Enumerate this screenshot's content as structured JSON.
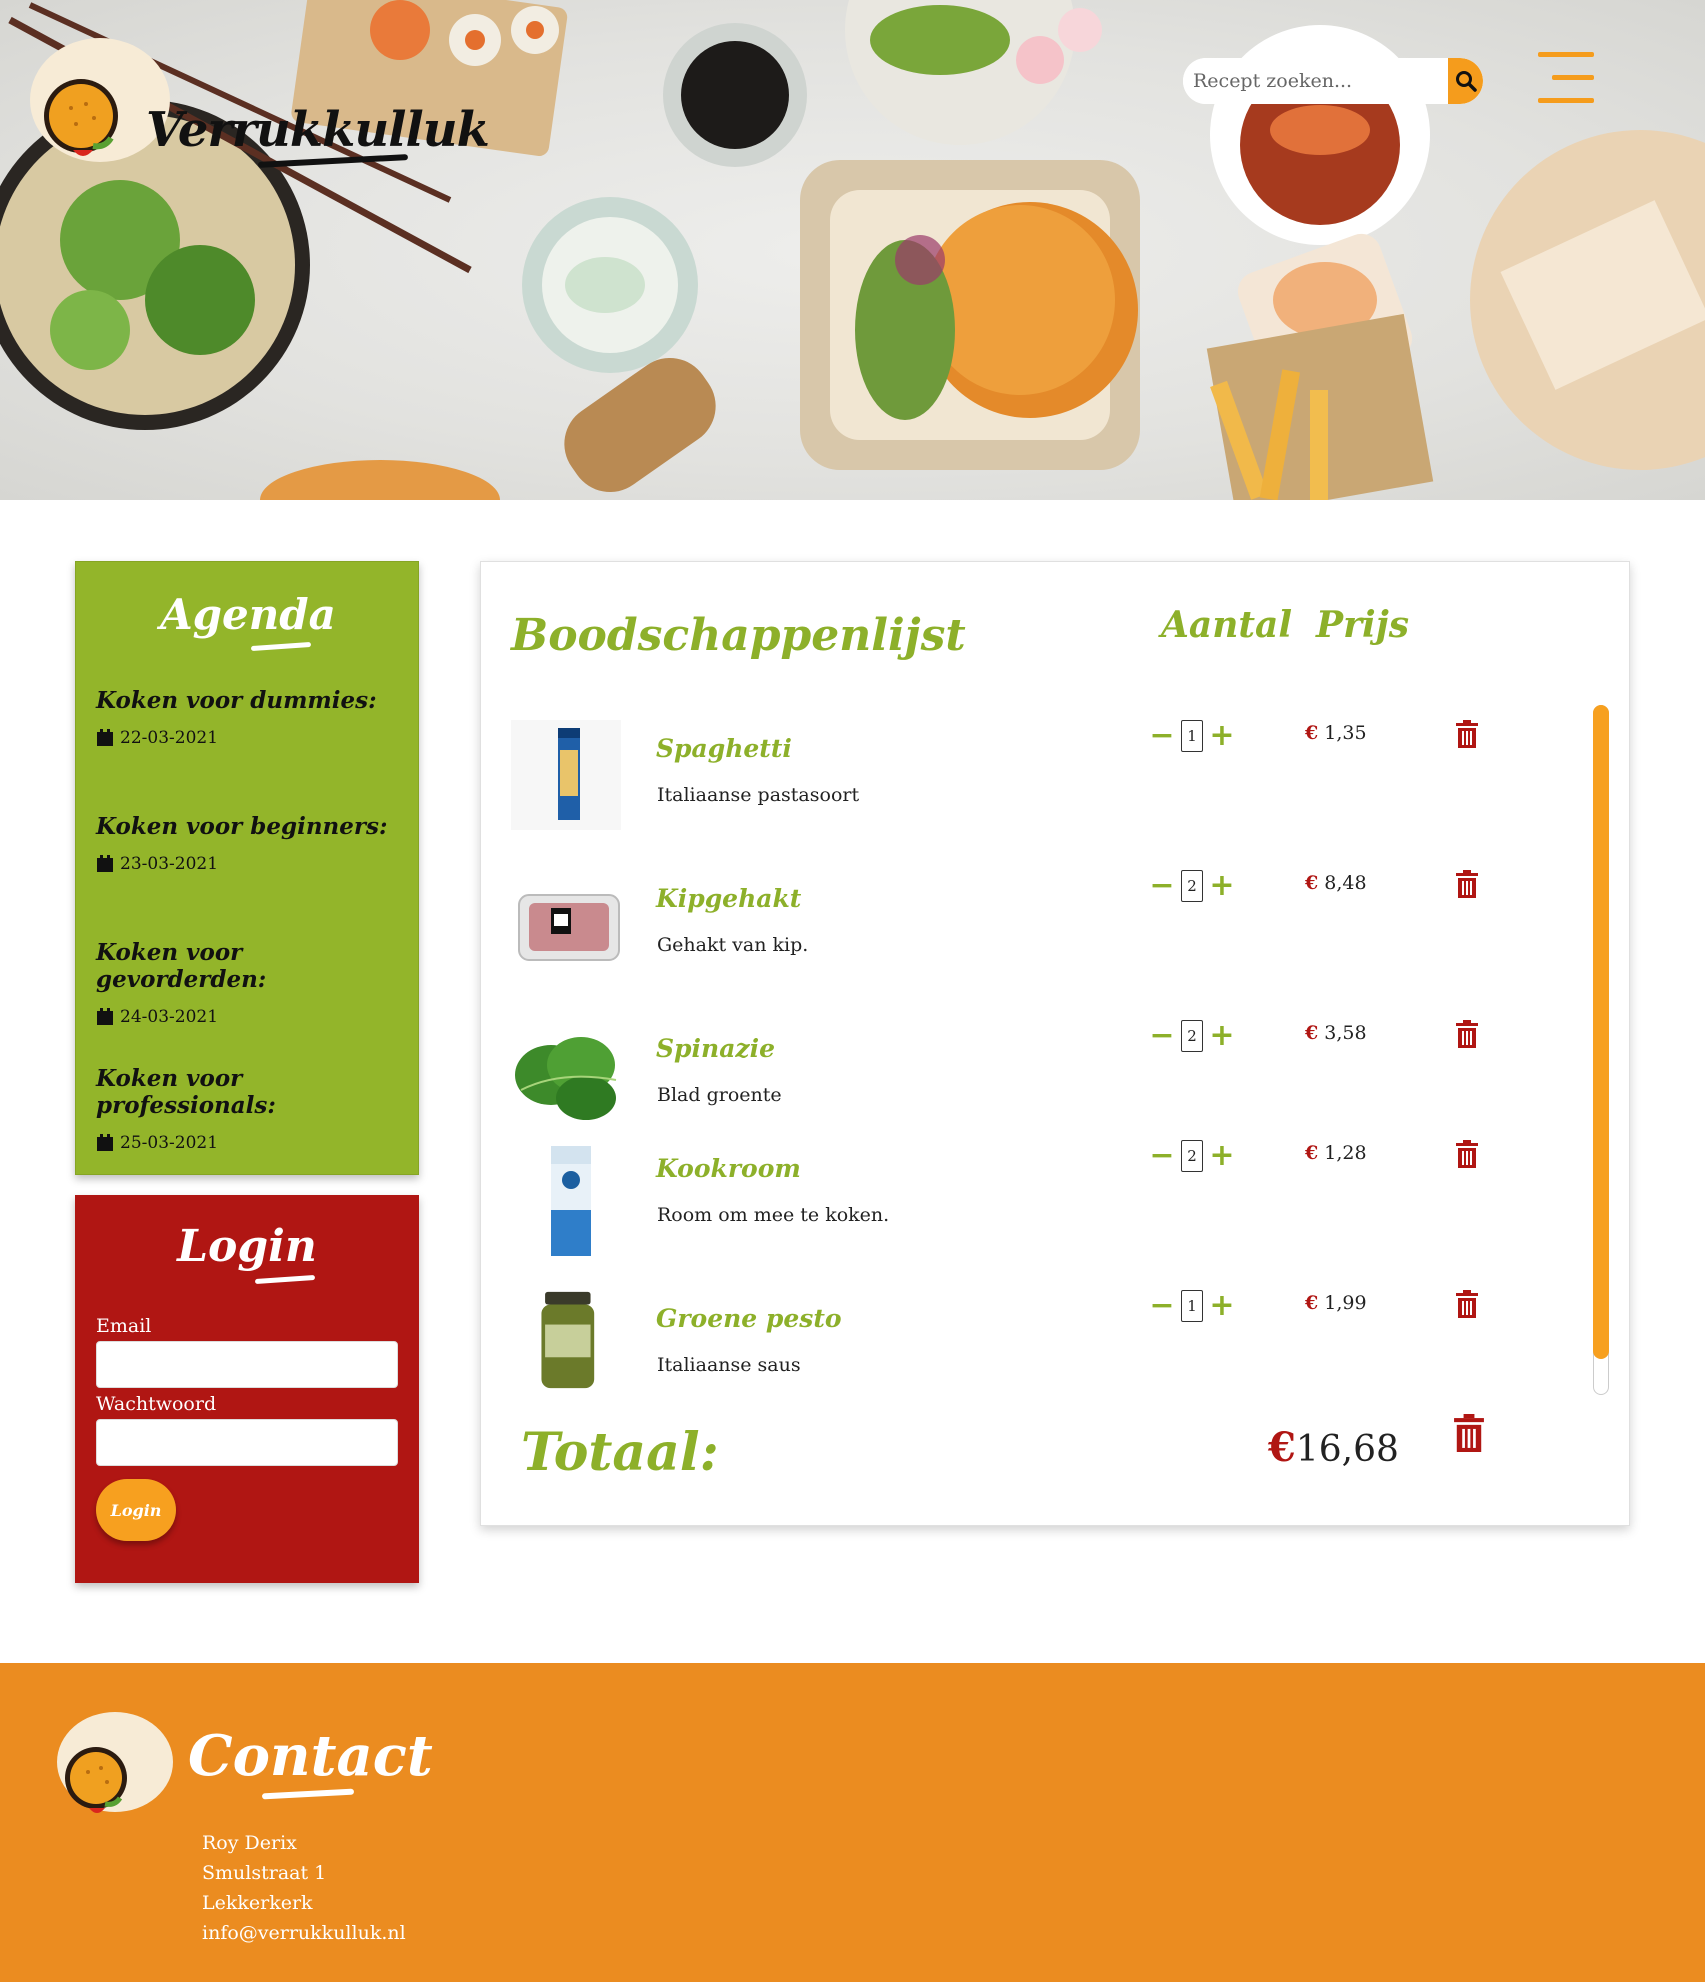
{
  "header": {
    "logo_text": "Verrukkulluk",
    "search_placeholder": "Recept zoeken..."
  },
  "agenda": {
    "title": "Agenda",
    "items": [
      {
        "name": "Koken voor dummies:",
        "date": "22-03-2021"
      },
      {
        "name": "Koken voor beginners:",
        "date": "23-03-2021"
      },
      {
        "name": "Koken voor gevorderden:",
        "date": "24-03-2021"
      },
      {
        "name": "Koken voor professionals:",
        "date": "25-03-2021"
      }
    ]
  },
  "login": {
    "title": "Login",
    "email_label": "Email",
    "password_label": "Wachtwoord",
    "button_label": "Login"
  },
  "list": {
    "title": "Boodschappenlijst",
    "col_aantal": "Aantal",
    "col_prijs": "Prijs",
    "currency": "€",
    "items": [
      {
        "name": "Spaghetti",
        "description": "Italiaanse pastasoort",
        "qty": "1",
        "price": "1,35"
      },
      {
        "name": "Kipgehakt",
        "description": "Gehakt van kip.",
        "qty": "2",
        "price": "8,48"
      },
      {
        "name": "Spinazie",
        "description": "Blad groente",
        "qty": "2",
        "price": "3,58"
      },
      {
        "name": "Kookroom",
        "description": "Room om mee te koken.",
        "qty": "2",
        "price": "1,28"
      },
      {
        "name": "Groene pesto",
        "description": "Italiaanse saus",
        "qty": "1",
        "price": "1,99"
      }
    ],
    "total_label": "Totaal:",
    "total_value": "16,68"
  },
  "footer": {
    "title": "Contact",
    "name": "Roy Derix",
    "street": "Smulstraat 1",
    "city": "Lekkerkerk",
    "email": "info@verrukkulluk.nl"
  },
  "colors": {
    "green": "#93b52a",
    "red": "#b01613",
    "orange": "#f7a01f",
    "footer_orange": "#eb8c20"
  }
}
